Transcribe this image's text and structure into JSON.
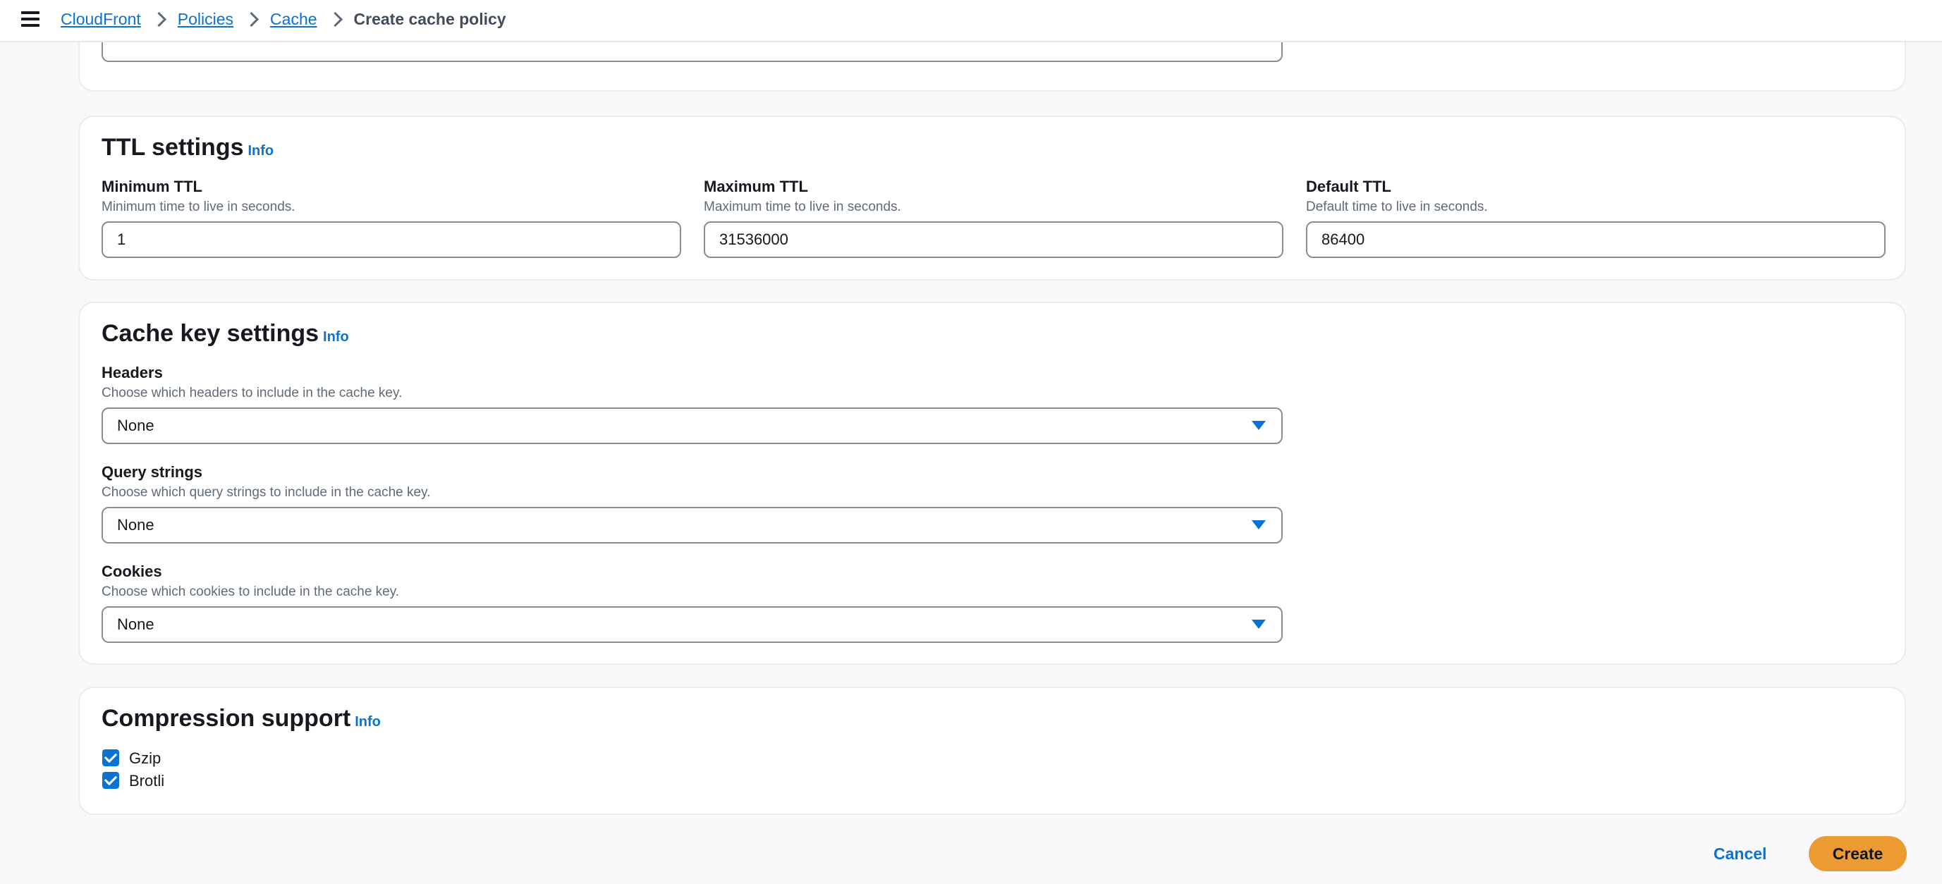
{
  "breadcrumb": {
    "items": [
      "CloudFront",
      "Policies",
      "Cache"
    ],
    "current": "Create cache policy"
  },
  "ttl": {
    "title": "TTL settings",
    "info": "Info",
    "min": {
      "label": "Minimum TTL",
      "desc": "Minimum time to live in seconds.",
      "value": "1"
    },
    "max": {
      "label": "Maximum TTL",
      "desc": "Maximum time to live in seconds.",
      "value": "31536000"
    },
    "def": {
      "label": "Default TTL",
      "desc": "Default time to live in seconds.",
      "value": "86400"
    }
  },
  "cache_key": {
    "title": "Cache key settings",
    "info": "Info",
    "headers": {
      "label": "Headers",
      "desc": "Choose which headers to include in the cache key.",
      "value": "None"
    },
    "query": {
      "label": "Query strings",
      "desc": "Choose which query strings to include in the cache key.",
      "value": "None"
    },
    "cookies": {
      "label": "Cookies",
      "desc": "Choose which cookies to include in the cache key.",
      "value": "None"
    }
  },
  "compression": {
    "title": "Compression support",
    "info": "Info",
    "gzip": "Gzip",
    "brotli": "Brotli"
  },
  "actions": {
    "cancel": "Cancel",
    "create": "Create"
  },
  "colors": {
    "accent": "#0972d3",
    "primary_button": "#ec9b32"
  }
}
